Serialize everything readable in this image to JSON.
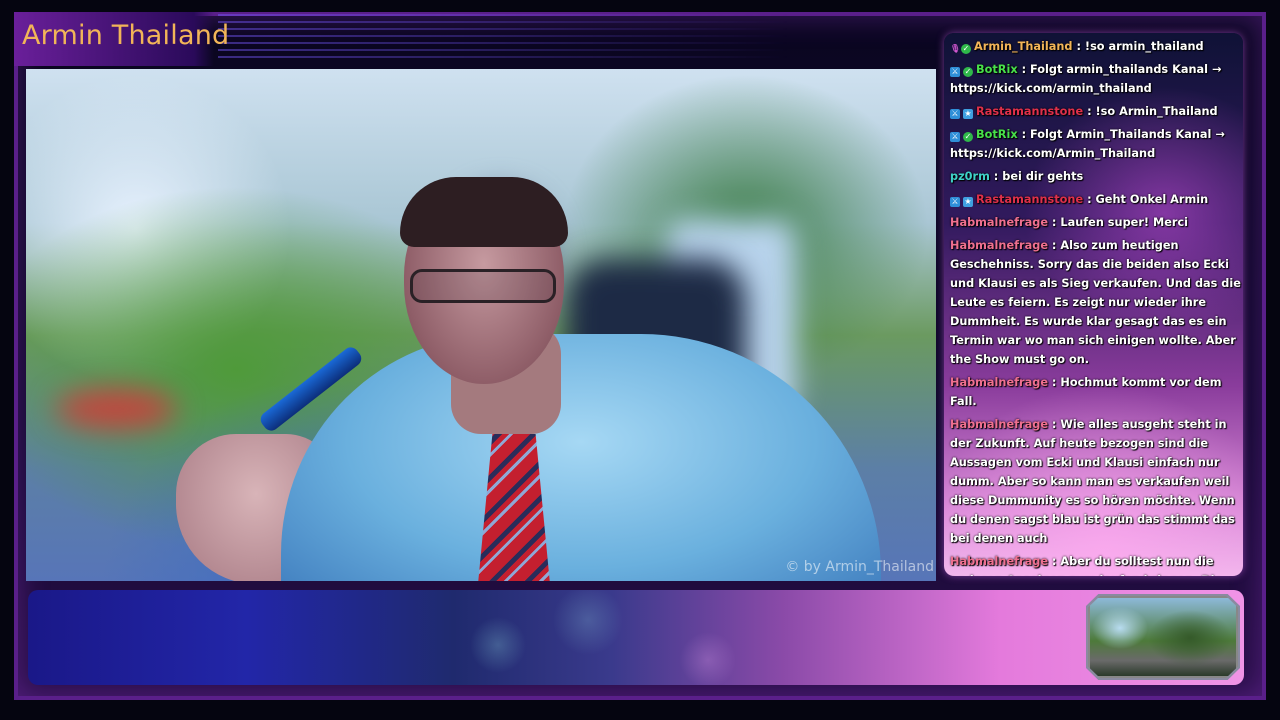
{
  "stream": {
    "channel_title": "Armin Thailand",
    "watermark": "© by Armin_Thailand"
  },
  "colors": {
    "title": "#f2b558",
    "frame": "#5a1f8a"
  },
  "chat": {
    "messages": [
      {
        "badges": [
          "mic-icon",
          "verified-icon"
        ],
        "user": "Armin_Thailand",
        "color": "#f2b558",
        "text": "!so armin_thailand"
      },
      {
        "badges": [
          "moderator-icon",
          "verified-icon"
        ],
        "user": "BotRix",
        "color": "#48e04a",
        "text": "Folgt armin_thailands Kanal → https://kick.com/armin_thailand"
      },
      {
        "badges": [
          "moderator-icon",
          "subscriber-icon"
        ],
        "user": "Rastamannstone",
        "color": "#e0304a",
        "text": "!so Armin_Thailand"
      },
      {
        "badges": [
          "moderator-icon",
          "verified-icon"
        ],
        "user": "BotRix",
        "color": "#48e04a",
        "text": "Folgt Armin_Thailands Kanal → https://kick.com/Armin_Thailand"
      },
      {
        "badges": [],
        "user": "pz0rm",
        "color": "#3fd2c8",
        "text": "bei dir gehts"
      },
      {
        "badges": [
          "moderator-icon",
          "subscriber-icon"
        ],
        "user": "Rastamannstone",
        "color": "#e0304a",
        "text": "Geht Onkel Armin"
      },
      {
        "badges": [],
        "user": "Habmalnefrage",
        "color": "#f07090",
        "text": "Laufen super! Merci"
      },
      {
        "badges": [],
        "user": "Habmalnefrage",
        "color": "#f07090",
        "text": "Also zum heutigen Geschehniss. Sorry das die beiden also Ecki und Klausi es als Sieg verkaufen. Und das die Leute es feiern. Es zeigt nur wieder ihre Dummheit. Es wurde klar gesagt das es ein Termin war wo man sich einigen wollte. Aber the Show must go on."
      },
      {
        "badges": [],
        "user": "Habmalnefrage",
        "color": "#f07090",
        "text": "Hochmut kommt vor dem Fall."
      },
      {
        "badges": [],
        "user": "Habmalnefrage",
        "color": "#f07090",
        "text": "Wie alles ausgeht steht in der Zukunft. Auf heute bezogen sind die Aussagen vom Ecki und Klausi einfach nur dumm. Aber so kann man es verkaufen weil diese Dummunity es so hören möchte. Wenn du denen sagst blau ist grün das stimmt das bei denen auch"
      },
      {
        "badges": [],
        "user": "Habmalnefrage",
        "color": "#f07090",
        "text": "Aber du solltest nun die anderen Anzeigen zum laufen bringen. Die Zeit ist genau die richtige. Damit der Klausi in Misskredit kommt bei der thailändische Justizbehörde"
      }
    ],
    "separator": " : "
  }
}
